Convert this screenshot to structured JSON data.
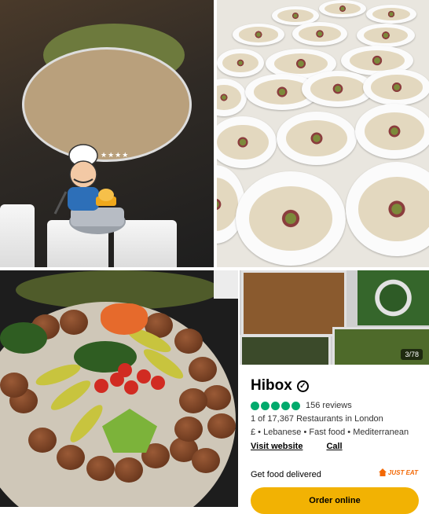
{
  "restaurant": {
    "name": "Hibox",
    "review_count": "156 reviews",
    "rating_dots": 5,
    "rank": "1 of 17,367 Restaurants in London",
    "categories": "£ • Lebanese • Fast food • Mediterranean",
    "visit_website": "Visit website",
    "call": "Call"
  },
  "delivery": {
    "label": "Get food delivered",
    "provider": "JUST EAT"
  },
  "order_button": "Order online",
  "gallery": {
    "counter": "3/78"
  },
  "colors": {
    "rating_green": "#00aa6c",
    "order_yellow": "#f2b203",
    "just_eat_orange": "#f36805"
  },
  "icons": [
    "verified-badge-icon",
    "just-eat-house-icon",
    "chef-mascot-icon"
  ]
}
